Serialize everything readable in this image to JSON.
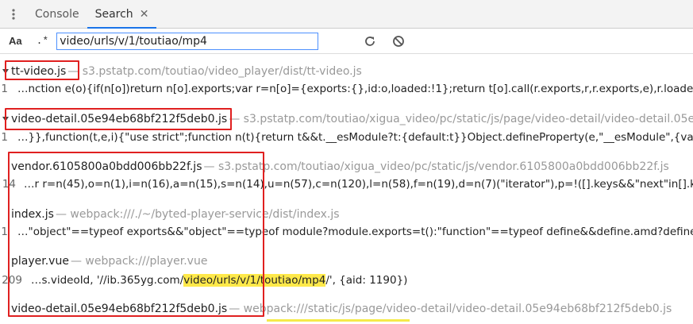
{
  "drawer": {
    "tabs": [
      {
        "label": "Console"
      },
      {
        "label": "Search"
      }
    ],
    "close_glyph": "✕"
  },
  "toolbar": {
    "case_label": "Aa",
    "regex_label": ".*",
    "search_value": "video/urls/v/1/toutiao/mp4",
    "refresh_icon": "refresh-icon",
    "clear_icon": "clear-icon"
  },
  "colors": {
    "highlight": "#ffe94a",
    "annotation_red": "#e02020",
    "active_tab": "#1a73e8"
  },
  "results": [
    {
      "file": "tt-video.js",
      "path": "— s3.pstatp.com/toutiao/video_player/dist/tt-video.js",
      "line": "1",
      "text": "…nction e(o){if(n[o])return n[o].exports;var r=n[o]={exports:{},id:o,loaded:!1};return t[o].call(r.exports,r,r.exports,e),r.loaded=!0,r.exports"
    },
    {
      "file": "video-detail.05e94eb68bf212f5deb0.js",
      "path": "— s3.pstatp.com/toutiao/xigua_video/pc/static/js/page/video-detail/video-detail.05e94eb68bf212f5deb0.js",
      "line": "1",
      "text": "…}},function(t,e,i){\"use strict\";function n(t){return t&&t.__esModule?t:{default:t}}Object.defineProperty(e,\"__esModule\",{value:!0});var"
    },
    {
      "file": "vendor.6105800a0bdd006bb22f.js",
      "path": "— s3.pstatp.com/toutiao/xigua_video/pc/static/js/vendor.6105800a0bdd006bb22f.js",
      "line": "14",
      "text": "…r r=n(45),o=n(1),i=n(16),a=n(15),s=n(14),u=n(57),c=n(120),l=n(58),f=n(19),d=n(7)(\"iterator\"),p=!([].keys&&\"next\"in[].keys()),h="
    },
    {
      "file": "index.js",
      "path": "— webpack:///./~/byted-player-service/dist/index.js",
      "line": "1",
      "text": "…\"object\"==typeof exports&&\"object\"==typeof module?module.exports=t():\"function\"==typeof define&&define.amd?define([],t):"
    },
    {
      "file": "player.vue",
      "path": "— webpack:///player.vue",
      "line": "209",
      "text_before": "…s.videoId, '//ib.365yg.com/",
      "text_match": "video/urls/v/1/toutiao/mp4",
      "text_after": "/', {aid: 1190})"
    },
    {
      "file": "video-detail.05e94eb68bf212f5deb0.js",
      "path": "— webpack:///static/js/page/video-detail/video-detail.05e94eb68bf212f5deb0.js"
    }
  ]
}
